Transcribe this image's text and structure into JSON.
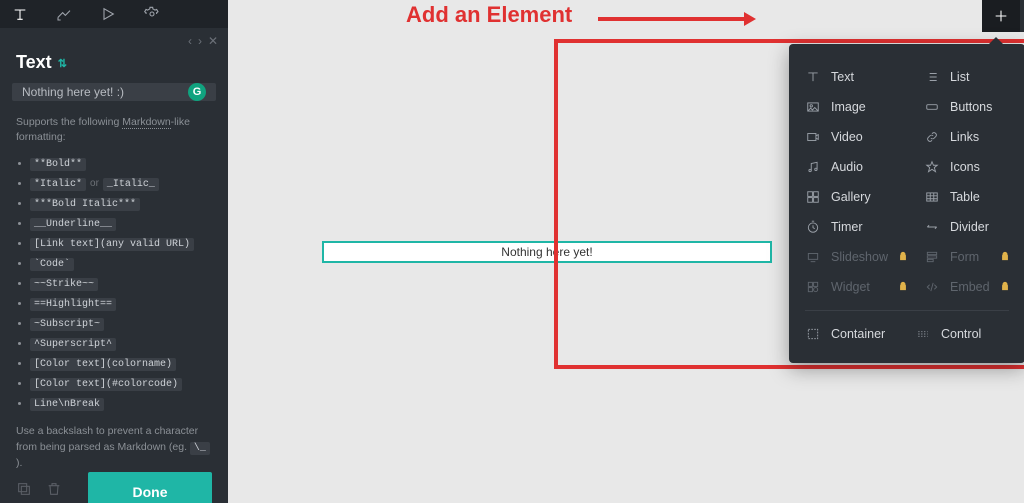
{
  "annotation": {
    "label": "Add an Element"
  },
  "sidebar": {
    "title": "Text",
    "input_value": "Nothing here yet! :)",
    "grammar_badge": "G",
    "help_intro_prefix": "Supports the following ",
    "help_intro_link": "Markdown",
    "help_intro_suffix": "-like formatting:",
    "formats": [
      [
        {
          "t": "code",
          "v": "**Bold**"
        }
      ],
      [
        {
          "t": "code",
          "v": "*Italic*"
        },
        {
          "t": "sep",
          "v": "or"
        },
        {
          "t": "code",
          "v": "_Italic_"
        }
      ],
      [
        {
          "t": "code",
          "v": "***Bold Italic***"
        }
      ],
      [
        {
          "t": "code",
          "v": "__Underline__"
        }
      ],
      [
        {
          "t": "code",
          "v": "[Link text](any valid URL)"
        }
      ],
      [
        {
          "t": "code",
          "v": "`Code`"
        }
      ],
      [
        {
          "t": "code",
          "v": "~~Strike~~"
        }
      ],
      [
        {
          "t": "code",
          "v": "==Highlight=="
        }
      ],
      [
        {
          "t": "code",
          "v": "~Subscript~"
        }
      ],
      [
        {
          "t": "code",
          "v": "^Superscript^"
        }
      ],
      [
        {
          "t": "code",
          "v": "[Color text](colorname)"
        }
      ],
      [
        {
          "t": "code",
          "v": "[Color text](#colorcode)"
        }
      ],
      [
        {
          "t": "code",
          "v": "Line\\nBreak"
        }
      ]
    ],
    "help_foot_prefix": "Use a backslash to prevent a character from being parsed as Markdown (eg. ",
    "help_foot_code": "\\_",
    "help_foot_suffix": " ).",
    "done_label": "Done"
  },
  "canvas": {
    "placeholder": "Nothing here yet!"
  },
  "dropdown": {
    "col1": [
      {
        "icon": "text",
        "label": "Text",
        "locked": false
      },
      {
        "icon": "image",
        "label": "Image",
        "locked": false
      },
      {
        "icon": "video",
        "label": "Video",
        "locked": false
      },
      {
        "icon": "audio",
        "label": "Audio",
        "locked": false
      },
      {
        "icon": "gallery",
        "label": "Gallery",
        "locked": false
      },
      {
        "icon": "timer",
        "label": "Timer",
        "locked": false
      },
      {
        "icon": "slideshow",
        "label": "Slideshow",
        "locked": true
      },
      {
        "icon": "widget",
        "label": "Widget",
        "locked": true
      }
    ],
    "col2": [
      {
        "icon": "list",
        "label": "List",
        "locked": false
      },
      {
        "icon": "buttons",
        "label": "Buttons",
        "locked": false
      },
      {
        "icon": "links",
        "label": "Links",
        "locked": false
      },
      {
        "icon": "icons",
        "label": "Icons",
        "locked": false
      },
      {
        "icon": "table",
        "label": "Table",
        "locked": false
      },
      {
        "icon": "divider",
        "label": "Divider",
        "locked": false
      },
      {
        "icon": "form",
        "label": "Form",
        "locked": true
      },
      {
        "icon": "embed",
        "label": "Embed",
        "locked": true
      }
    ],
    "footer": [
      {
        "icon": "container",
        "label": "Container"
      },
      {
        "icon": "control",
        "label": "Control"
      }
    ]
  }
}
